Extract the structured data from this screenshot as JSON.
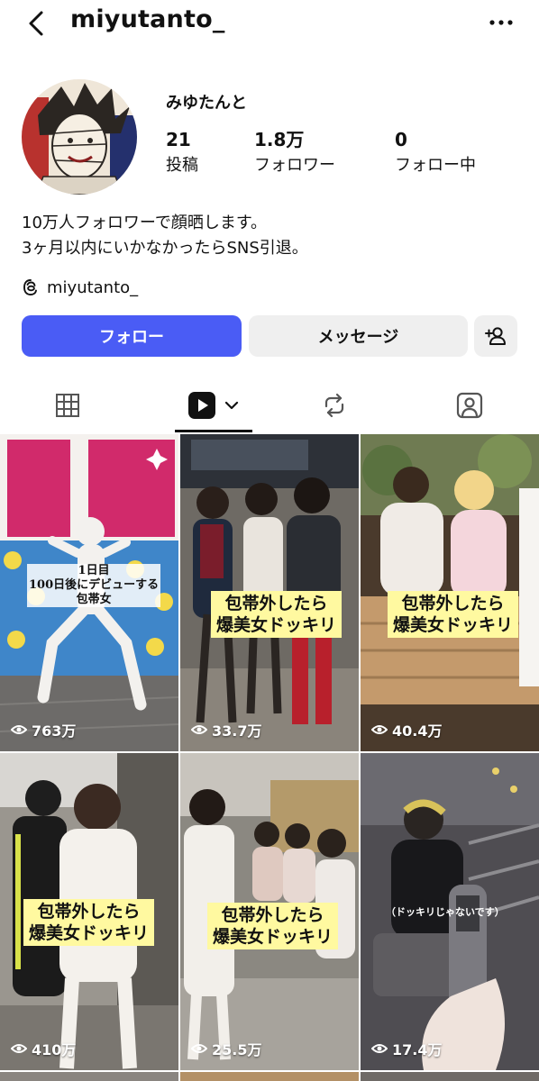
{
  "header": {
    "username": "miyutanto_"
  },
  "profile": {
    "display_name": "みゆたんと",
    "stats": [
      {
        "value": "21",
        "label": "投稿"
      },
      {
        "value": "1.8万",
        "label": "フォロワー"
      },
      {
        "value": "0",
        "label": "フォロー中"
      }
    ],
    "bio_lines": [
      "10万人フォロワーで顔晒します。",
      "3ヶ月以内にいかなかったらSNS引退。"
    ],
    "threads_handle": "miyutanto_"
  },
  "actions": {
    "follow": "フォロー",
    "message": "メッセージ"
  },
  "tabs": [
    "grid-icon",
    "reels-icon",
    "reposts-icon",
    "tagged-icon"
  ],
  "colors": {
    "follow_button": "#4a5cf5",
    "secondary_button": "#efefef",
    "caption_bg": "#fff9a0"
  },
  "reels": [
    {
      "day_label": "1日目",
      "caption_lines": [
        "100日後にデビューする",
        "包帯女"
      ],
      "views": "763万"
    },
    {
      "caption_lines": [
        "包帯外したら",
        "爆美女ドッキリ"
      ],
      "views": "33.7万"
    },
    {
      "caption_lines": [
        "包帯外したら",
        "爆美女ドッキリ"
      ],
      "views": "40.4万"
    },
    {
      "caption_lines": [
        "包帯外したら",
        "爆美女ドッキリ"
      ],
      "views": "410万"
    },
    {
      "caption_lines": [
        "包帯外したら",
        "爆美女ドッキリ"
      ],
      "views": "25.5万"
    },
    {
      "subtitle": "（ドッキリじゃないです）",
      "views": "17.4万"
    }
  ]
}
